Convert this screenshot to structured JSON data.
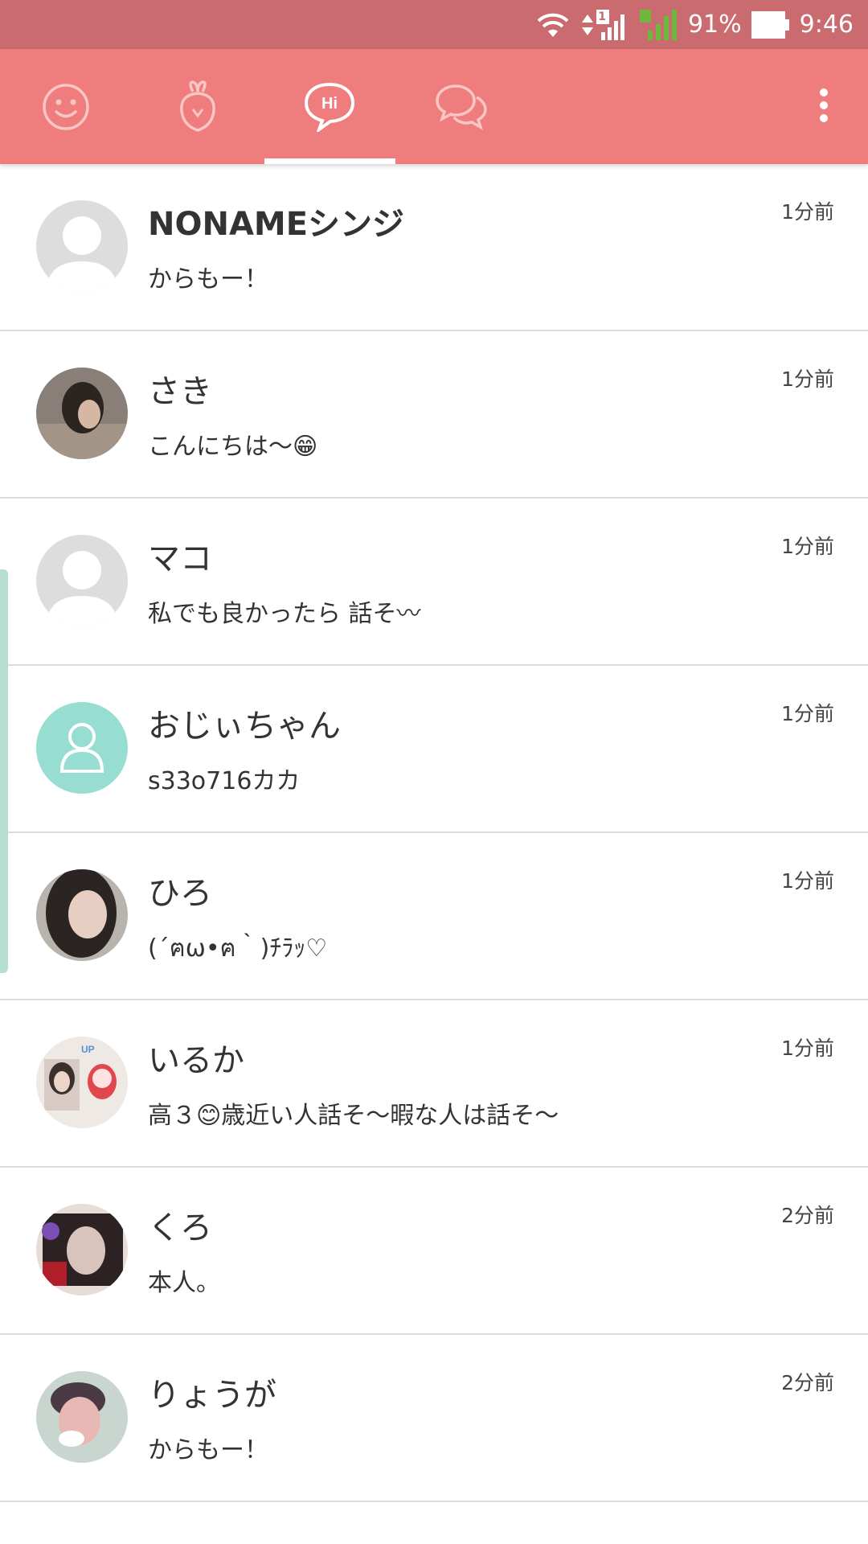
{
  "status_bar": {
    "battery": "91%",
    "time": "9:46",
    "signal_badge": "1",
    "colors": {
      "background": "#c96b6f"
    }
  },
  "tab_bar": {
    "colors": {
      "background": "#f07d7d",
      "indicator": "#ffffff"
    },
    "tabs": [
      {
        "icon": "smiley-icon",
        "active": false
      },
      {
        "icon": "turnip-icon",
        "active": false
      },
      {
        "icon": "hi-bubble-icon",
        "active": true,
        "label": "Hi"
      },
      {
        "icon": "chat-bubbles-icon",
        "active": false
      }
    ],
    "menu_icon": "more-vertical-icon"
  },
  "messages": [
    {
      "name": "NONAMEシンジ",
      "message": "からもー！",
      "time": "1分前",
      "avatar": "default-gray"
    },
    {
      "name": "さき",
      "message": "こんにちは〜😁",
      "time": "1分前",
      "avatar": "photo"
    },
    {
      "name": "マコ",
      "message": "私でも良かったら 話そ〰",
      "time": "1分前",
      "avatar": "default-gray"
    },
    {
      "name": "おじぃちゃん",
      "message": "s33o716カカ",
      "time": "1分前",
      "avatar": "default-teal"
    },
    {
      "name": "ひろ",
      "message": "(´ฅω•ฅ｀)ﾁﾗｯ♡",
      "time": "1分前",
      "avatar": "photo"
    },
    {
      "name": "いるか",
      "message": "高３😊歳近い人話そ〜暇な人は話そ〜",
      "time": "1分前",
      "avatar": "photo"
    },
    {
      "name": "くろ",
      "message": "本人。",
      "time": "2分前",
      "avatar": "photo"
    },
    {
      "name": "りょうが",
      "message": "からもー！",
      "time": "2分前",
      "avatar": "photo"
    }
  ]
}
